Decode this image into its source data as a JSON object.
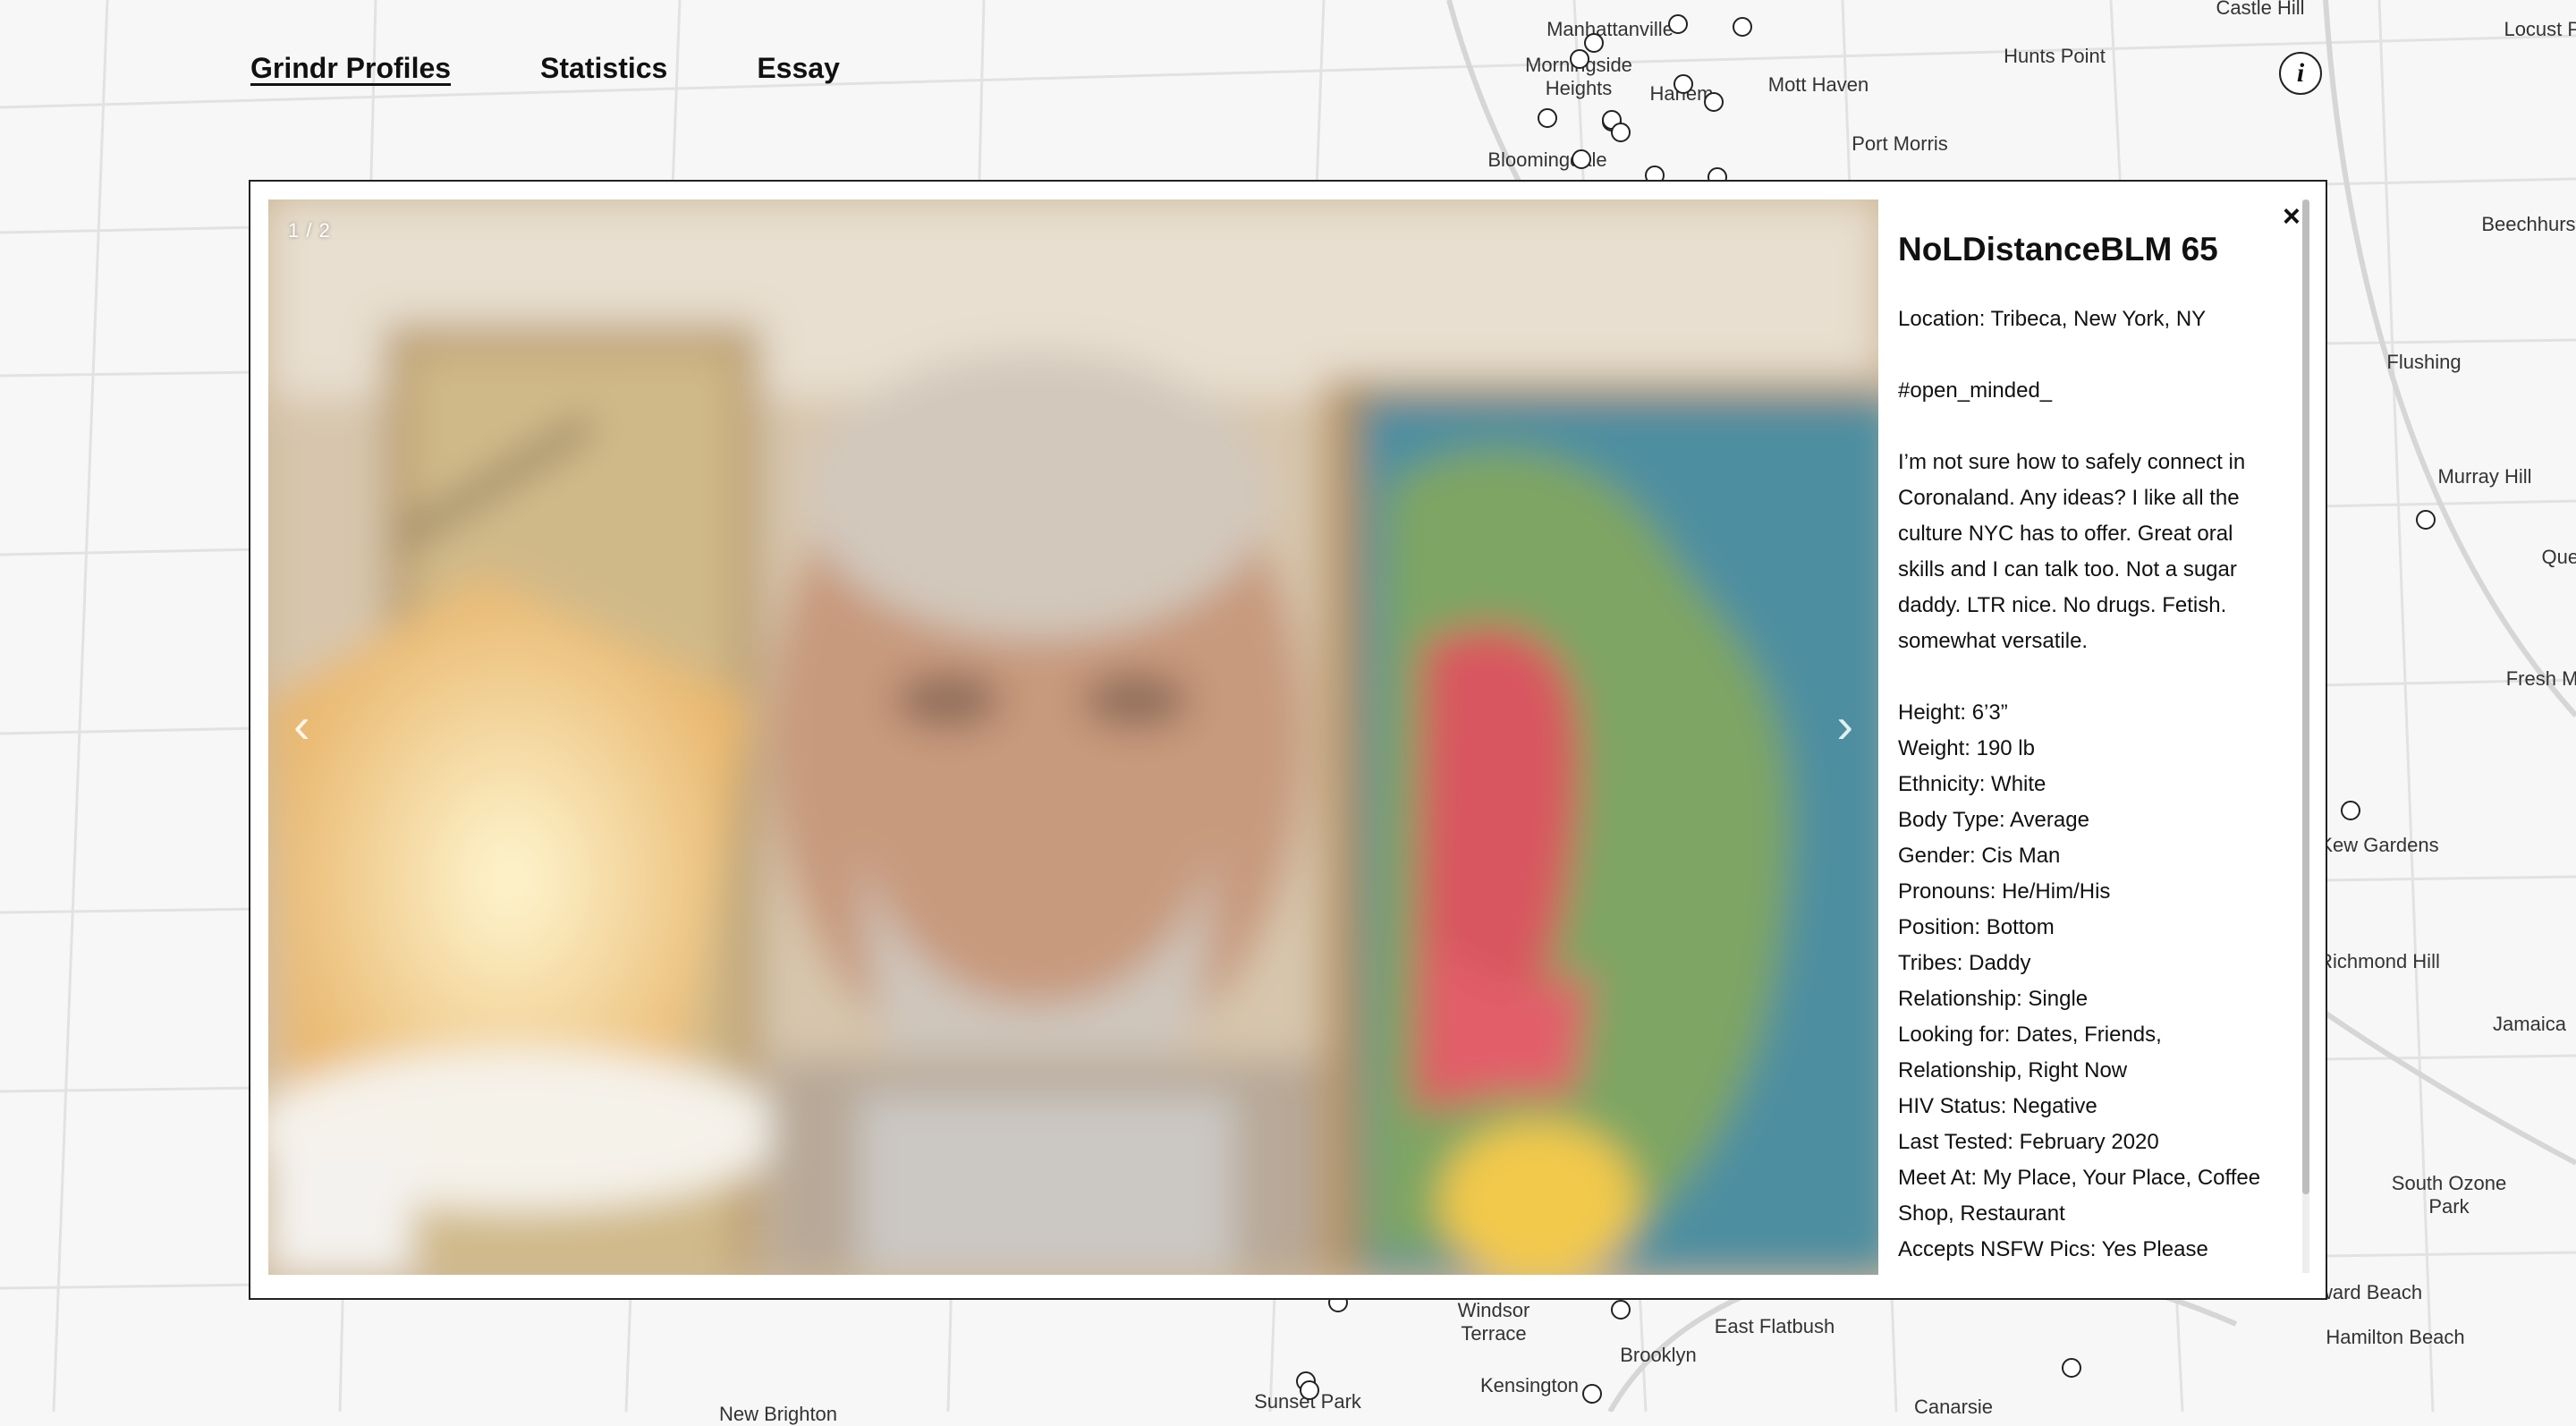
{
  "nav": {
    "items": [
      {
        "label": "Grindr Profiles",
        "active": true
      },
      {
        "label": "Statistics",
        "active": false
      },
      {
        "label": "Essay",
        "active": false
      }
    ],
    "info_icon": "info-icon"
  },
  "map": {
    "labels": [
      "Manhattanville",
      "Morningside Heights",
      "Harlem",
      "Mott Haven",
      "Hunts Point",
      "Castle Hill",
      "Locust Point",
      "Port Morris",
      "Bloomingdale",
      "Beechhurst",
      "Flushing",
      "Murray Hill",
      "Queens",
      "Fresh Meadows",
      "Kew Gardens",
      "Richmond Hill",
      "Jamaica",
      "South Ozone Park",
      "Howard Beach",
      "Hamilton Beach",
      "Windsor Terrace",
      "East Flatbush",
      "Brooklyn",
      "Kensington",
      "Sunset Park",
      "Canarsie",
      "New Brighton"
    ]
  },
  "modal": {
    "slide_counter": "1 / 2",
    "prev_icon": "chevron-left-icon",
    "next_icon": "chevron-right-icon",
    "close_label": "×",
    "profile": {
      "name": "NoLDistanceBLM 65",
      "location": "Location: Tribeca, New York, NY",
      "tagline": "#open_minded_",
      "bio": [
        "I’m not sure how to safely connect in",
        "Coronaland. Any ideas? I like all the",
        "culture NYC has to offer. Great oral",
        "skills and I can talk too. Not a sugar",
        "daddy. LTR nice. No drugs. Fetish.",
        "somewhat versatile."
      ],
      "attributes": [
        "Height: 6’3”",
        "Weight: 190 lb",
        "Ethnicity: White",
        "Body Type: Average",
        "Gender: Cis Man",
        "Pronouns: He/Him/His",
        "Position: Bottom",
        "Tribes: Daddy",
        "Relationship: Single",
        "Looking for: Dates, Friends,",
        "Relationship, Right Now",
        "HIV Status: Negative",
        "Last Tested: February 2020",
        "Meet At: My Place, Your Place, Coffee",
        "Shop, Restaurant",
        "Accepts NSFW Pics: Yes Please"
      ]
    }
  }
}
